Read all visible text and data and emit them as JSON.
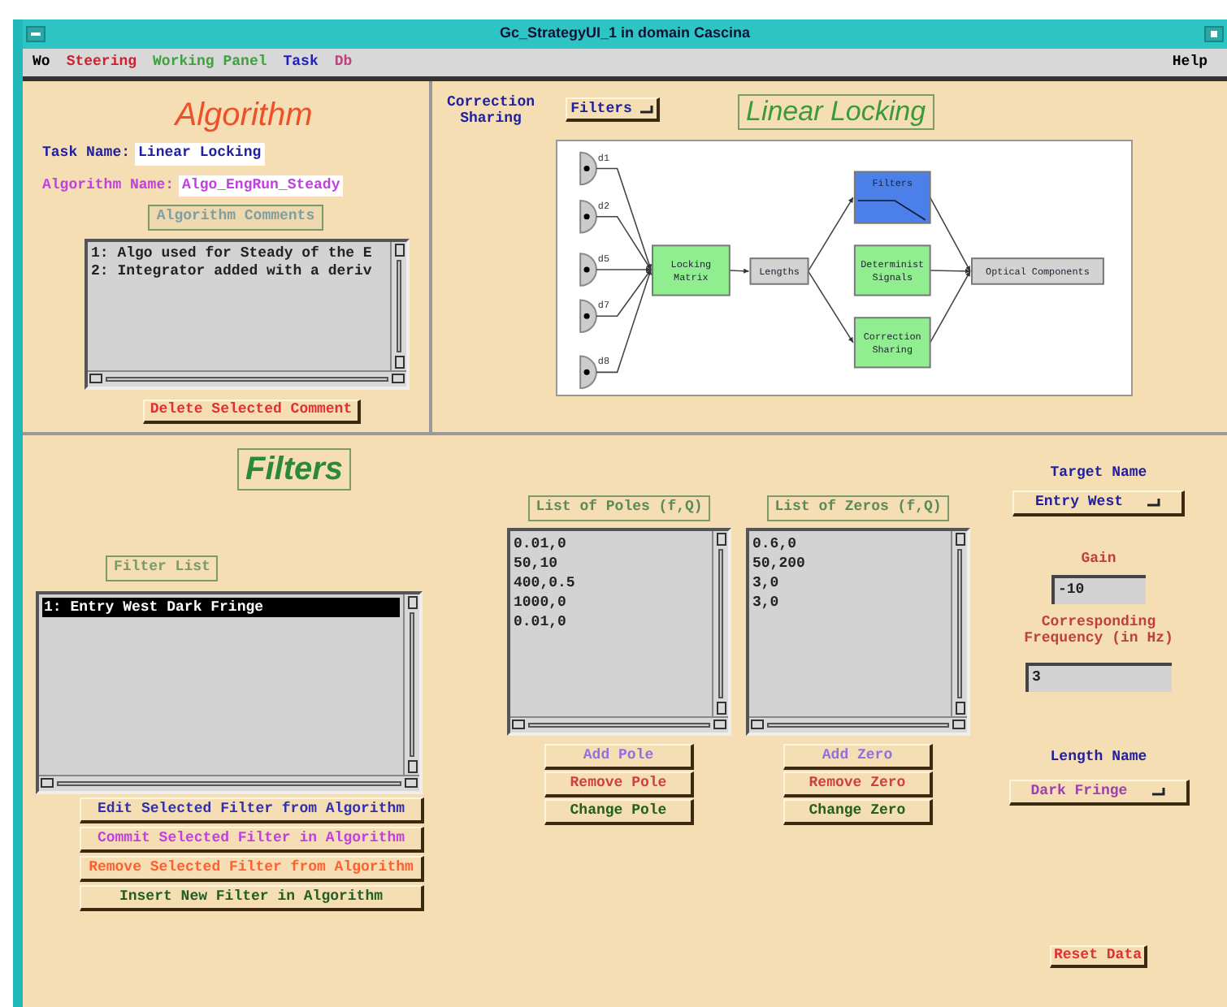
{
  "window": {
    "title": "Gc_StrategyUI_1 in domain Cascina"
  },
  "menu": [
    {
      "label": "Wo",
      "color": "#000000"
    },
    {
      "label": "Steering",
      "color": "#d02030"
    },
    {
      "label": "Working Panel",
      "color": "#40a040"
    },
    {
      "label": "Task",
      "color": "#2020c0"
    },
    {
      "label": "Db",
      "color": "#c04080"
    }
  ],
  "help": "Help",
  "algorithm": {
    "title": "Algorithm",
    "task_name_label": "Task Name:",
    "task_name": "Linear Locking",
    "algorithm_name_label": "Algorithm Name:",
    "algorithm_name": "Algo_EngRun_Steady",
    "comments_label": "Algorithm Comments",
    "comments": [
      "1: Algo used for Steady of the E",
      "2: Integrator added with a deriv"
    ],
    "delete_button": "Delete Selected Comment"
  },
  "linear_locking": {
    "correction_sharing_label": "Correction Sharing",
    "dropdown": "Filters",
    "title": "Linear Locking",
    "diagram": {
      "detectors": [
        "d1",
        "d2",
        "d5",
        "d7",
        "d8"
      ],
      "blocks": [
        {
          "lines": [
            "Locking",
            "Matrix"
          ],
          "color": "#90ee90"
        },
        {
          "lines": [
            "Lengths"
          ],
          "color": "#d3d3d3"
        },
        {
          "lines": [
            "Filters"
          ],
          "color": "#4a80e8"
        },
        {
          "lines": [
            "Determinist",
            "Signals"
          ],
          "color": "#90ee90"
        },
        {
          "lines": [
            "Correction",
            "Sharing"
          ],
          "color": "#90ee90"
        },
        {
          "lines": [
            "Optical  Components"
          ],
          "color": "#d3d3d3"
        }
      ]
    }
  },
  "filters": {
    "title": "Filters",
    "filter_list_label": "Filter List",
    "filter_list": [
      {
        "label": "1: Entry West Dark Fringe",
        "selected": true
      }
    ],
    "actions": [
      {
        "label": "Edit Selected Filter from Algorithm",
        "color": "#3030b0"
      },
      {
        "label": "Commit Selected Filter in Algorithm",
        "color": "#c040e0"
      },
      {
        "label": "Remove Selected Filter from Algorithm",
        "color": "#ff6030"
      },
      {
        "label": "Insert New Filter in Algorithm",
        "color": "#206020"
      }
    ],
    "poles": {
      "label": "List of Poles (f,Q)",
      "items": [
        "0.01,0",
        "50,10",
        "400,0.5",
        "1000,0",
        "0.01,0"
      ],
      "buttons": [
        {
          "label": "Add Pole",
          "color": "#9070e0"
        },
        {
          "label": "Remove Pole",
          "color": "#d04040"
        },
        {
          "label": "Change Pole",
          "color": "#206020"
        }
      ]
    },
    "zeros": {
      "label": "List of Zeros (f,Q)",
      "items": [
        "0.6,0",
        "50,200",
        "3,0",
        "3,0"
      ],
      "buttons": [
        {
          "label": "Add Zero",
          "color": "#9070e0"
        },
        {
          "label": "Remove Zero",
          "color": "#d04040"
        },
        {
          "label": "Change Zero",
          "color": "#206020"
        }
      ]
    },
    "target_name_label": "Target Name",
    "target_name": "Entry West",
    "gain_label": "Gain",
    "gain": "-10",
    "frequency_label": "Corresponding Frequency (in Hz)",
    "frequency": "3",
    "length_name_label": "Length Name",
    "length_name": "Dark Fringe",
    "reset_button": "Reset Data"
  }
}
